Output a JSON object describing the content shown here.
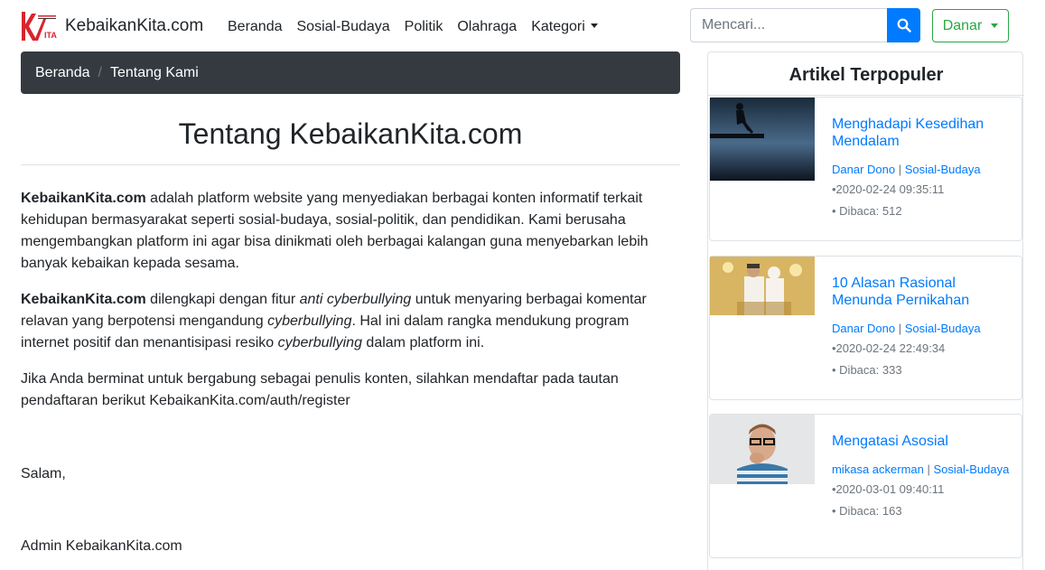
{
  "brand": {
    "logo_text": "KEBAIKAN KITA",
    "name": "KebaikanKita.com"
  },
  "nav": {
    "items": [
      {
        "label": "Beranda"
      },
      {
        "label": "Sosial-Budaya"
      },
      {
        "label": "Politik"
      },
      {
        "label": "Olahraga"
      },
      {
        "label": "Kategori"
      }
    ]
  },
  "search": {
    "placeholder": "Mencari...",
    "icon": "search-icon"
  },
  "user_menu": {
    "label": "Danar"
  },
  "breadcrumb": {
    "home": "Beranda",
    "current": "Tentang Kami"
  },
  "main": {
    "title": "Tentang KebaikanKita.com",
    "p1": {
      "strong": "KebaikanKita.com",
      "text": " adalah platform website yang menyediakan berbagai konten informatif terkait kehidupan bermasyarakat seperti sosial-budaya, sosial-politik, dan pendidikan. Kami berusaha mengembangkan platform ini agar bisa dinikmati oleh berbagai kalangan guna menyebarkan lebih banyak kebaikan kepada sesama."
    },
    "p2": {
      "strong": "KebaikanKita.com",
      "t1": " dilengkapi dengan fitur ",
      "em1": "anti cyberbullying",
      "t2": " untuk menyaring berbagai komentar relavan yang berpotensi mengandung ",
      "em2": "cyberbullying",
      "t3": ". Hal ini dalam rangka mendukung program internet positif dan menantisipasi resiko ",
      "em3": "cyberbullying",
      "t4": " dalam platform ini."
    },
    "p3": "Jika Anda berminat untuk bergabung sebagai penulis konten, silahkan mendaftar pada tautan pendaftaran berikut KebaikanKita.com/auth/register",
    "salam": "Salam,",
    "signature": "Admin KebaikanKita.com"
  },
  "sidebar": {
    "title": "Artikel Terpopuler",
    "articles": [
      {
        "title": "Menghadapi Kesedihan Mendalam",
        "author": "Danar Dono",
        "category": "Sosial-Budaya",
        "date": "•2020-02-24 09:35:11",
        "views": "• Dibaca: 512"
      },
      {
        "title": "10 Alasan Rasional Menunda Pernikahan",
        "author": "Danar Dono",
        "category": "Sosial-Budaya",
        "date": "•2020-02-24 22:49:34",
        "views": "• Dibaca: 333"
      },
      {
        "title": "Mengatasi Asosial",
        "author": "mikasa ackerman",
        "category": "Sosial-Budaya",
        "date": "•2020-03-01 09:40:11",
        "views": "• Dibaca: 163"
      }
    ]
  },
  "colors": {
    "primary": "#007bff",
    "success": "#28a745",
    "dark": "#343a40",
    "brand_red": "#d9232d"
  }
}
